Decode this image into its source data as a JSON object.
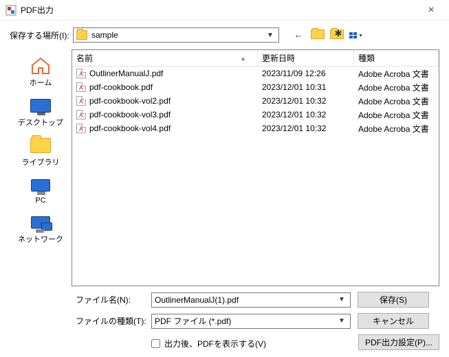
{
  "window": {
    "title": "PDF出力"
  },
  "save_in": {
    "label": "保存する場所(I):",
    "value": "sample"
  },
  "sidebar": {
    "items": [
      {
        "label": "ホーム"
      },
      {
        "label": "デスクトップ"
      },
      {
        "label": "ライブラリ"
      },
      {
        "label": "PC"
      },
      {
        "label": "ネットワーク"
      }
    ]
  },
  "columns": {
    "name": "名前",
    "date": "更新日時",
    "type": "種類"
  },
  "files": [
    {
      "name": "OutlinerManualJ.pdf",
      "date": "2023/11/09 12:26",
      "type": "Adobe Acroba 文書"
    },
    {
      "name": "pdf-cookbook.pdf",
      "date": "2023/12/01 10:31",
      "type": "Adobe Acroba 文書"
    },
    {
      "name": "pdf-cookbook-vol2.pdf",
      "date": "2023/12/01 10:32",
      "type": "Adobe Acroba 文書"
    },
    {
      "name": "pdf-cookbook-vol3.pdf",
      "date": "2023/12/01 10:32",
      "type": "Adobe Acroba 文書"
    },
    {
      "name": "pdf-cookbook-vol4.pdf",
      "date": "2023/12/01 10:32",
      "type": "Adobe Acroba 文書"
    }
  ],
  "form": {
    "filename_label": "ファイル名(N):",
    "filename_value": "OutlinerManualJ(1).pdf",
    "filetype_label": "ファイルの種類(T):",
    "filetype_value": "PDF ファイル (*.pdf)",
    "show_after_label": "出力後、PDFを表示する(V)"
  },
  "buttons": {
    "save": "保存(S)",
    "cancel": "キャンセル",
    "settings": "PDF出力設定(P)..."
  }
}
